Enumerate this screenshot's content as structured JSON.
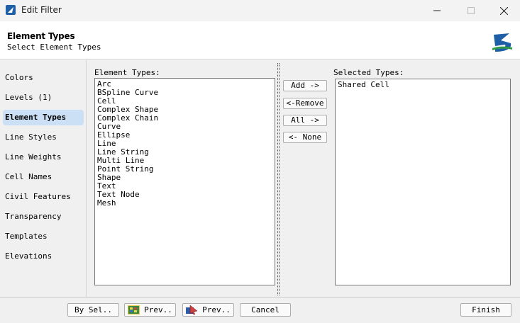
{
  "window": {
    "title": "Edit Filter"
  },
  "header": {
    "title": "Element Types",
    "subtitle": "Select Element Types"
  },
  "sidebar": {
    "items": [
      {
        "label": "Colors"
      },
      {
        "label": "Levels (1)"
      },
      {
        "label": "Element Types"
      },
      {
        "label": "Line Styles"
      },
      {
        "label": "Line Weights"
      },
      {
        "label": "Cell Names"
      },
      {
        "label": "Civil Features"
      },
      {
        "label": "Transparency"
      },
      {
        "label": "Templates"
      },
      {
        "label": "Elevations"
      }
    ],
    "active": "Element Types"
  },
  "available": {
    "label": "Element Types:",
    "items": [
      "Arc",
      "BSpline Curve",
      "Cell",
      "Complex Shape",
      "Complex Chain",
      "Curve",
      "Ellipse",
      "Line",
      "Line String",
      "Multi Line",
      "Point String",
      "Shape",
      "Text",
      "Text Node",
      "Mesh"
    ]
  },
  "selected": {
    "label": "Selected Types:",
    "items": [
      "Shared Cell"
    ]
  },
  "transfer": {
    "add": "Add ->",
    "remove": "<-Remove",
    "all": "All ->",
    "none": "<- None"
  },
  "footer": {
    "by_sel": "By Sel..",
    "prev1": "Prev..",
    "prev2": "Prev..",
    "cancel": "Cancel",
    "finish": "Finish"
  },
  "colors": {
    "active_nav": "#cce0f5",
    "brand_blue": "#1f5fa8",
    "brand_green": "#2e9a45"
  }
}
